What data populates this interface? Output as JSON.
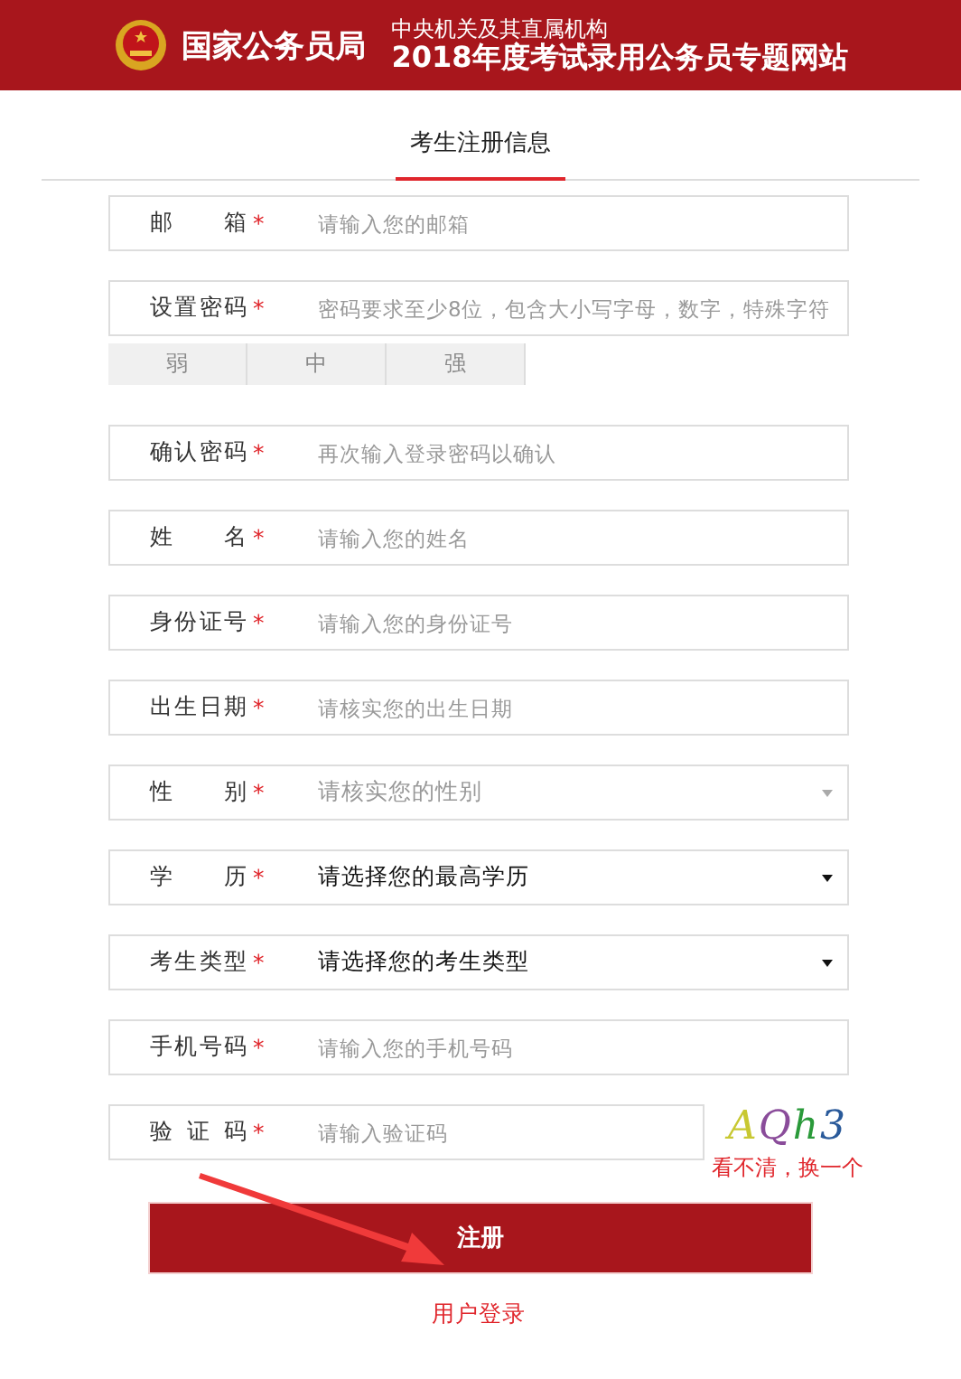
{
  "header": {
    "agency": "国家公务员局",
    "subtitle": "中央机关及其直属机构",
    "title": "2018年度考试录用公务员专题网站"
  },
  "tab": {
    "label": "考生注册信息",
    "selected": true
  },
  "fields": [
    {
      "kind": "text",
      "label": "邮 箱",
      "required": "*",
      "placeholder": "请输入您的邮箱"
    },
    {
      "kind": "text",
      "label": "设置密码",
      "required": "*",
      "placeholder": "密码要求至少8位，包含大小写字母，数字，特殊字符",
      "strength": [
        {
          "label": "弱",
          "selected": false
        },
        {
          "label": "中",
          "selected": false
        },
        {
          "label": "强",
          "selected": false
        }
      ]
    },
    {
      "kind": "text",
      "label": "确认密码",
      "required": "*",
      "placeholder": "再次输入登录密码以确认"
    },
    {
      "kind": "text",
      "label": "姓 名",
      "required": "*",
      "placeholder": "请输入您的姓名"
    },
    {
      "kind": "text",
      "label": "身份证号",
      "required": "*",
      "placeholder": "请输入您的身份证号"
    },
    {
      "kind": "text",
      "label": "出生日期",
      "required": "*",
      "placeholder": "请核实您的出生日期"
    },
    {
      "kind": "select",
      "label": "性 别",
      "required": "*",
      "placeholder": "请核实您的性别"
    },
    {
      "kind": "select",
      "label": "学 历",
      "required": "*",
      "value": "请选择您的最高学历"
    },
    {
      "kind": "select",
      "label": "考生类型",
      "required": "*",
      "value": "请选择您的考生类型"
    },
    {
      "kind": "text",
      "label": "手机号码",
      "required": "*",
      "placeholder": "请输入您的手机号码"
    },
    {
      "kind": "captcha",
      "label": "验 证 码",
      "required": "*",
      "placeholder": "请输入验证码",
      "captcha": "AQh3",
      "refresh": "看不清，换一个"
    }
  ],
  "submit": "注册",
  "login_link": "用户登录"
}
